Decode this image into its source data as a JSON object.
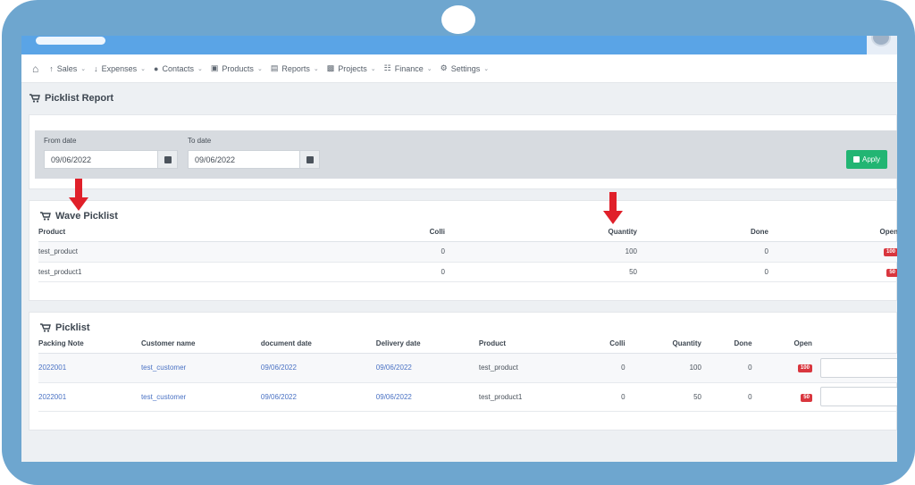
{
  "navbar": {
    "items": [
      {
        "label": "Sales",
        "icon": "arrow-up-icon"
      },
      {
        "label": "Expenses",
        "icon": "arrow-down-icon"
      },
      {
        "label": "Contacts",
        "icon": "user-icon"
      },
      {
        "label": "Products",
        "icon": "cart-icon"
      },
      {
        "label": "Reports",
        "icon": "chart-icon"
      },
      {
        "label": "Projects",
        "icon": "briefcase-icon"
      },
      {
        "label": "Finance",
        "icon": "money-icon"
      },
      {
        "label": "Settings",
        "icon": "gear-icon"
      }
    ]
  },
  "page": {
    "title": "Picklist Report"
  },
  "filter": {
    "from_label": "From date",
    "from_value": "09/06/2022",
    "to_label": "To date",
    "to_value": "09/06/2022",
    "apply_label": "Apply"
  },
  "wave": {
    "title": "Wave Picklist",
    "headers": [
      "Product",
      "Colli",
      "Quantity",
      "Done",
      "Open"
    ],
    "rows": [
      {
        "product": "test_product",
        "colli": "0",
        "quantity": "100",
        "done": "0",
        "open": "100"
      },
      {
        "product": "test_product1",
        "colli": "0",
        "quantity": "50",
        "done": "0",
        "open": "50"
      }
    ]
  },
  "picklist": {
    "title": "Picklist",
    "headers": [
      "Packing Note",
      "Customer name",
      "document date",
      "Delivery date",
      "Product",
      "Colli",
      "Quantity",
      "Done",
      "Open"
    ],
    "rows": [
      {
        "note": "2022001",
        "customer": "test_customer",
        "doc_date": "09/06/2022",
        "delivery": "09/06/2022",
        "product": "test_product",
        "colli": "0",
        "quantity": "100",
        "done": "0",
        "open": "100"
      },
      {
        "note": "2022001",
        "customer": "test_customer",
        "doc_date": "09/06/2022",
        "delivery": "09/06/2022",
        "product": "test_product1",
        "colli": "0",
        "quantity": "50",
        "done": "0",
        "open": "50"
      }
    ]
  },
  "colors": {
    "frame": "#6ea6cf",
    "topbar": "#5aa4e6",
    "apply": "#22b573",
    "badge": "#d9363e",
    "link": "#4a72c4",
    "arrow": "#e0202a"
  }
}
